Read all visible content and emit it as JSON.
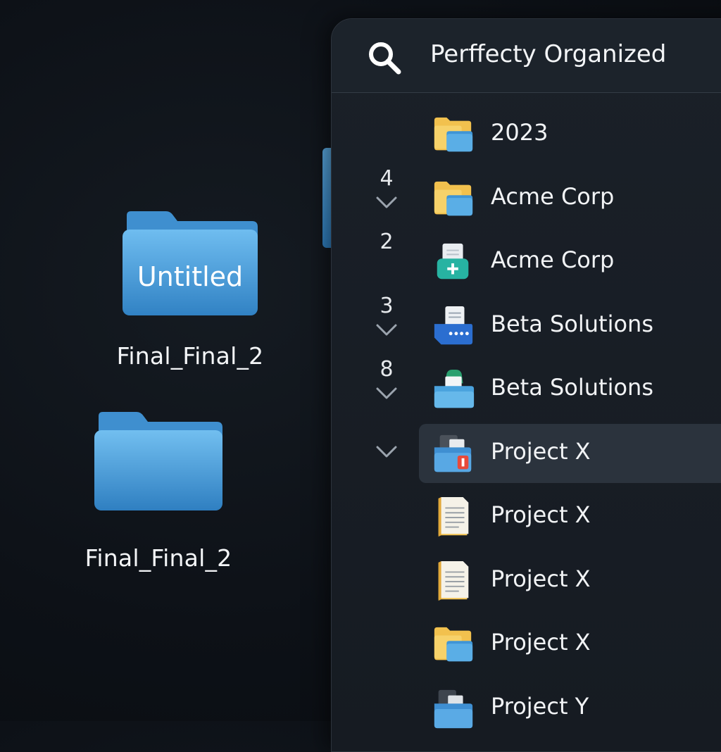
{
  "desktop": {
    "folders": [
      {
        "badge": "Untitled",
        "label": "Final_Final_2"
      },
      {
        "badge": "",
        "label": "Final_Final_2"
      }
    ]
  },
  "panel": {
    "title": "Perffecty Organized",
    "search_icon": "search-icon",
    "rows": [
      {
        "count": "",
        "chevron": false,
        "label": "2023",
        "icon": "folder-yellow-blue-icon"
      },
      {
        "count": "4",
        "chevron": true,
        "label": "Acme Corp",
        "icon": "folder-yellow-blue-icon"
      },
      {
        "count": "2",
        "chevron": false,
        "label": "Acme Corp",
        "icon": "medical-kit-document-icon"
      },
      {
        "count": "3",
        "chevron": true,
        "label": "Beta Solutions",
        "icon": "document-chat-icon"
      },
      {
        "count": "8",
        "chevron": true,
        "label": "Beta Solutions",
        "icon": "folder-printer-icon"
      },
      {
        "count": "",
        "chevron": true,
        "label": "Project X",
        "icon": "folder-red-badge-icon",
        "selected": true
      },
      {
        "count": "",
        "chevron": false,
        "label": "Project X",
        "icon": "yellow-document-icon"
      },
      {
        "count": "",
        "chevron": false,
        "label": "Project X",
        "icon": "yellow-document-icon"
      },
      {
        "count": "",
        "chevron": false,
        "label": "Project X",
        "icon": "folder-yellow-blue-icon"
      },
      {
        "count": "",
        "chevron": false,
        "label": "Project Y",
        "icon": "folder-dark-blue-icon"
      }
    ]
  },
  "colors": {
    "folder_blue": "#4aa0dc",
    "folder_yellow": "#f2c14e",
    "selected_row": "#2b333d",
    "panel_bg": "#181e25"
  }
}
